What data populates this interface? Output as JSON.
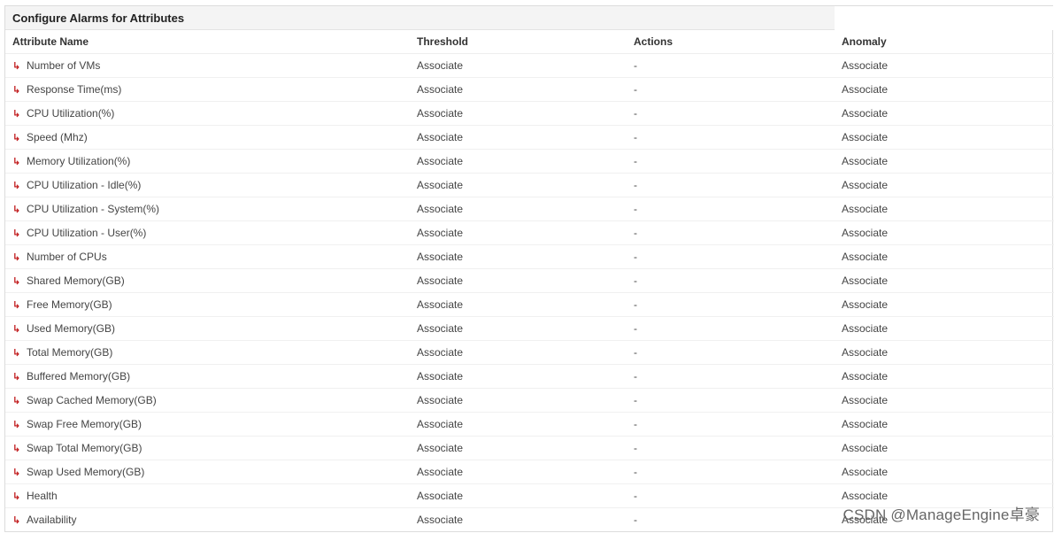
{
  "panel": {
    "title": "Configure Alarms for Attributes"
  },
  "columns": {
    "attribute_name": "Attribute Name",
    "threshold": "Threshold",
    "actions": "Actions",
    "anomaly": "Anomaly"
  },
  "rows": [
    {
      "name": "Number of VMs",
      "threshold": "Associate",
      "actions": "-",
      "anomaly": "Associate"
    },
    {
      "name": "Response Time(ms)",
      "threshold": "Associate",
      "actions": "-",
      "anomaly": "Associate"
    },
    {
      "name": "CPU Utilization(%)",
      "threshold": "Associate",
      "actions": "-",
      "anomaly": "Associate"
    },
    {
      "name": "Speed (Mhz)",
      "threshold": "Associate",
      "actions": "-",
      "anomaly": "Associate"
    },
    {
      "name": "Memory Utilization(%)",
      "threshold": "Associate",
      "actions": "-",
      "anomaly": "Associate"
    },
    {
      "name": "CPU Utilization - Idle(%)",
      "threshold": "Associate",
      "actions": "-",
      "anomaly": "Associate"
    },
    {
      "name": "CPU Utilization - System(%)",
      "threshold": "Associate",
      "actions": "-",
      "anomaly": "Associate"
    },
    {
      "name": "CPU Utilization - User(%)",
      "threshold": "Associate",
      "actions": "-",
      "anomaly": "Associate"
    },
    {
      "name": "Number of CPUs",
      "threshold": "Associate",
      "actions": "-",
      "anomaly": "Associate"
    },
    {
      "name": "Shared Memory(GB)",
      "threshold": "Associate",
      "actions": "-",
      "anomaly": "Associate"
    },
    {
      "name": "Free Memory(GB)",
      "threshold": "Associate",
      "actions": "-",
      "anomaly": "Associate"
    },
    {
      "name": "Used Memory(GB)",
      "threshold": "Associate",
      "actions": "-",
      "anomaly": "Associate"
    },
    {
      "name": "Total Memory(GB)",
      "threshold": "Associate",
      "actions": "-",
      "anomaly": "Associate"
    },
    {
      "name": "Buffered Memory(GB)",
      "threshold": "Associate",
      "actions": "-",
      "anomaly": "Associate"
    },
    {
      "name": "Swap Cached Memory(GB)",
      "threshold": "Associate",
      "actions": "-",
      "anomaly": "Associate"
    },
    {
      "name": "Swap Free Memory(GB)",
      "threshold": "Associate",
      "actions": "-",
      "anomaly": "Associate"
    },
    {
      "name": "Swap Total Memory(GB)",
      "threshold": "Associate",
      "actions": "-",
      "anomaly": "Associate"
    },
    {
      "name": "Swap Used Memory(GB)",
      "threshold": "Associate",
      "actions": "-",
      "anomaly": "Associate"
    },
    {
      "name": "Health",
      "threshold": "Associate",
      "actions": "-",
      "anomaly": "Associate"
    },
    {
      "name": "Availability",
      "threshold": "Associate",
      "actions": "-",
      "anomaly": "Associate"
    }
  ],
  "row_icon": "arrow-return-icon",
  "watermark": "CSDN @ManageEngine卓豪",
  "colors": {
    "arrow": "#c0181a",
    "header_bg": "#f4f4f4"
  }
}
